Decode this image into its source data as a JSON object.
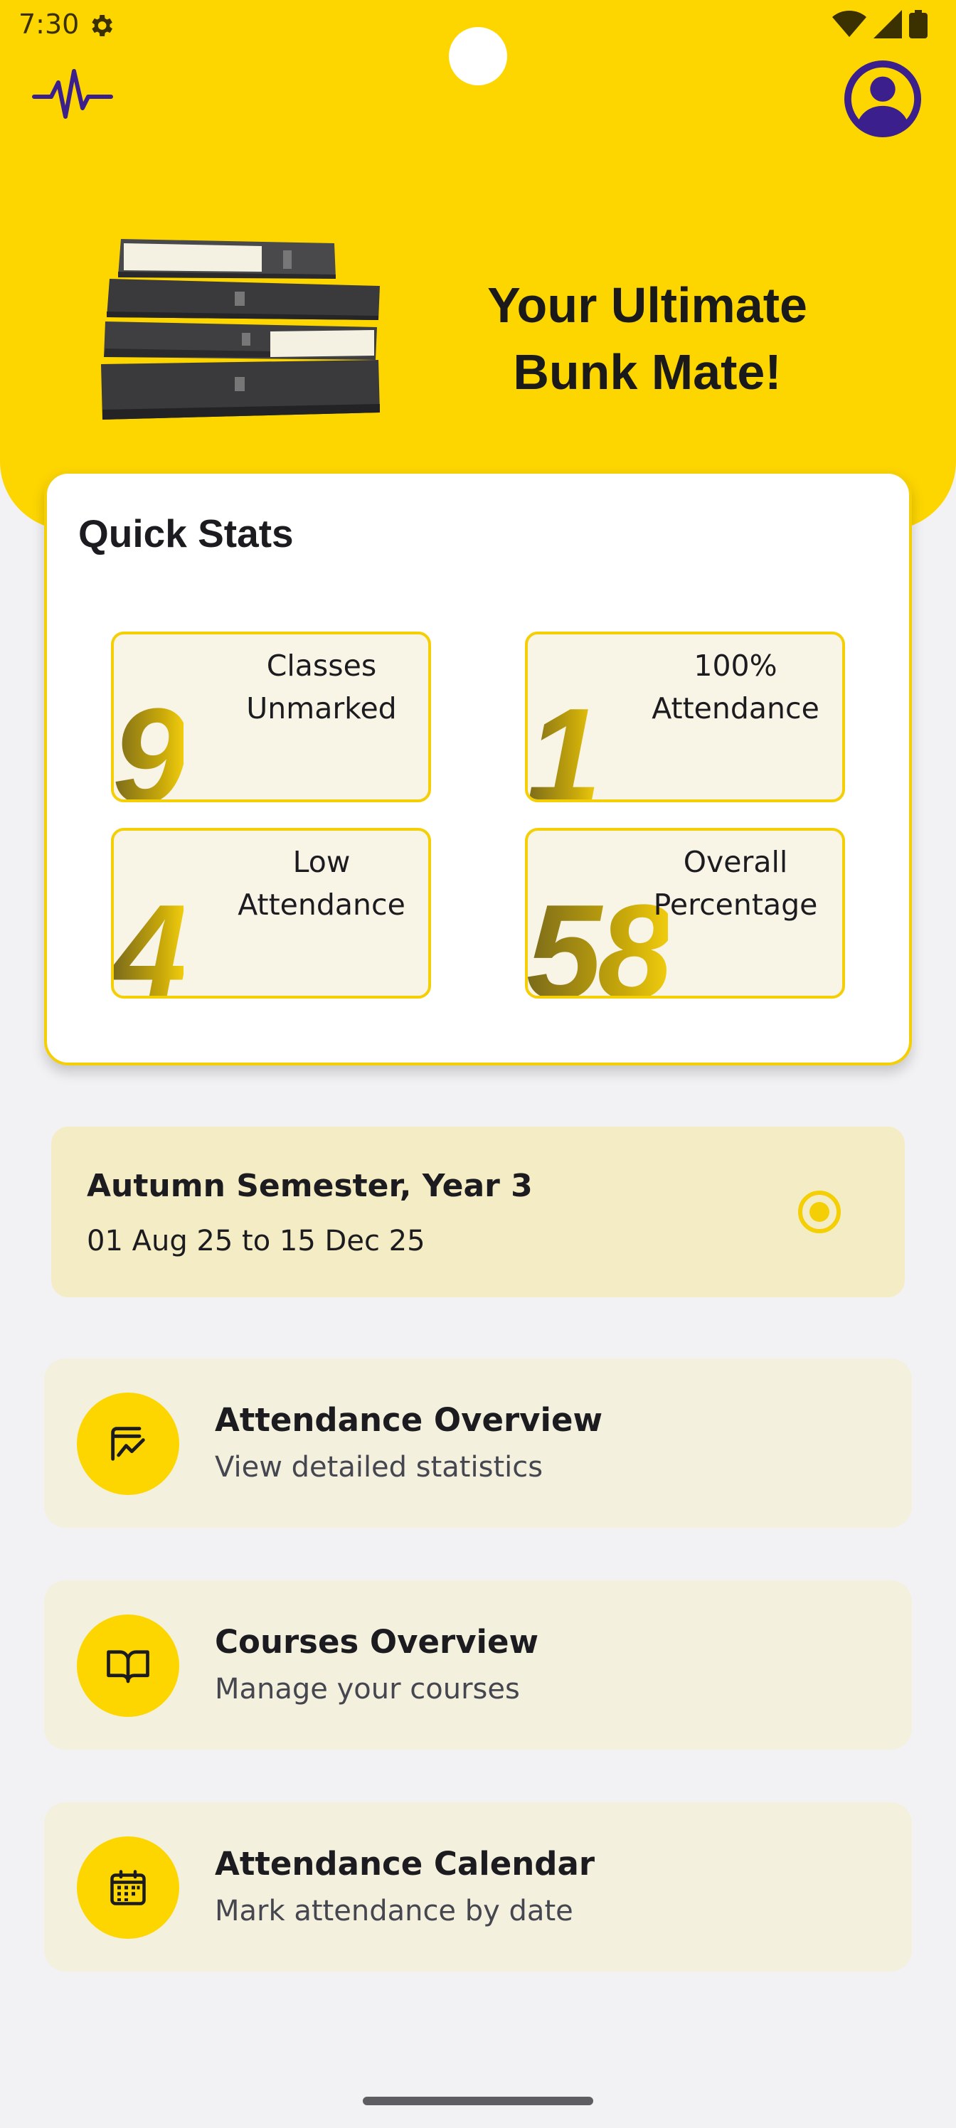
{
  "status_bar": {
    "time": "7:30",
    "icons": [
      "settings-gear-icon",
      "wifi-icon",
      "signal-icon",
      "battery-icon"
    ]
  },
  "header": {
    "app_icon": "pulse-waveform-icon",
    "profile_icon": "account-circle-icon",
    "image": "stack-of-books",
    "tagline_line1": "Your Ultimate",
    "tagline_line2": "Bunk Mate!",
    "accent_color": "#fdd600"
  },
  "quick_stats": {
    "title": "Quick Stats",
    "items": [
      {
        "value": "9",
        "label_line1": "Classes",
        "label_line2": "Unmarked"
      },
      {
        "value": "1",
        "label_line1": "100%",
        "label_line2": "Attendance"
      },
      {
        "value": "4",
        "label_line1": "Low",
        "label_line2": "Attendance"
      },
      {
        "value": "58",
        "label_line1": "Overall",
        "label_line2": "Percentage"
      }
    ]
  },
  "semester": {
    "name": "Autumn Semester, Year 3",
    "dates": "01 Aug 25 to 15 Dec 25",
    "selected": true
  },
  "menu": [
    {
      "title": "Attendance Overview",
      "subtitle": "View detailed statistics",
      "icon": "chart-trend-icon"
    },
    {
      "title": "Courses Overview",
      "subtitle": "Manage your courses",
      "icon": "open-book-icon"
    },
    {
      "title": "Attendance Calendar",
      "subtitle": "Mark attendance by date",
      "icon": "calendar-icon"
    }
  ]
}
